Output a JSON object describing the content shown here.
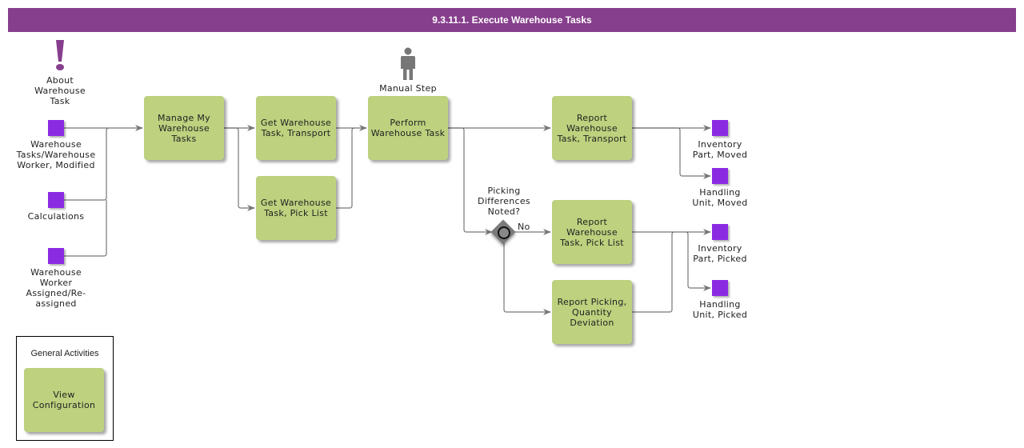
{
  "title": "9.3.11.1. Execute Warehouse Tasks",
  "colors": {
    "title_bar": "#863f8c",
    "task_fill": "#bdd17e",
    "event_fill": "#8a2be2",
    "connector": "#777777",
    "annotation_icon": "#863f8c",
    "manual_icon": "#777777"
  },
  "annotations": {
    "about": {
      "icon": "exclamation-icon",
      "label": "About\nWarehouse\nTask"
    },
    "manual_step": {
      "icon": "person-icon",
      "label": "Manual Step"
    }
  },
  "input_events": [
    {
      "label": "Warehouse\nTasks/Warehouse\nWorker, Modified"
    },
    {
      "label": "Calculations"
    },
    {
      "label": "Warehouse\nWorker\nAssigned/Re-\nassigned"
    }
  ],
  "tasks": {
    "manage": "Manage My\nWarehouse\nTasks",
    "get_transport": "Get Warehouse\nTask, Transport",
    "get_pick_list": "Get Warehouse\nTask, Pick List",
    "perform": "Perform\nWarehouse Task",
    "report_transport": "Report\nWarehouse\nTask, Transport",
    "report_pick_list": "Report\nWarehouse\nTask, Pick List",
    "report_picking_deviation": "Report Picking,\nQuantity\nDeviation"
  },
  "gateway": {
    "question": "Picking\nDifferences\nNoted?",
    "no_label": "No"
  },
  "output_events": [
    {
      "label": "Inventory\nPart, Moved"
    },
    {
      "label": "Handling\nUnit, Moved"
    },
    {
      "label": "Inventory\nPart, Picked"
    },
    {
      "label": "Handling\nUnit, Picked"
    }
  ],
  "general_activities": {
    "title": "General Activities",
    "tasks": [
      "View\nConfiguration"
    ]
  }
}
